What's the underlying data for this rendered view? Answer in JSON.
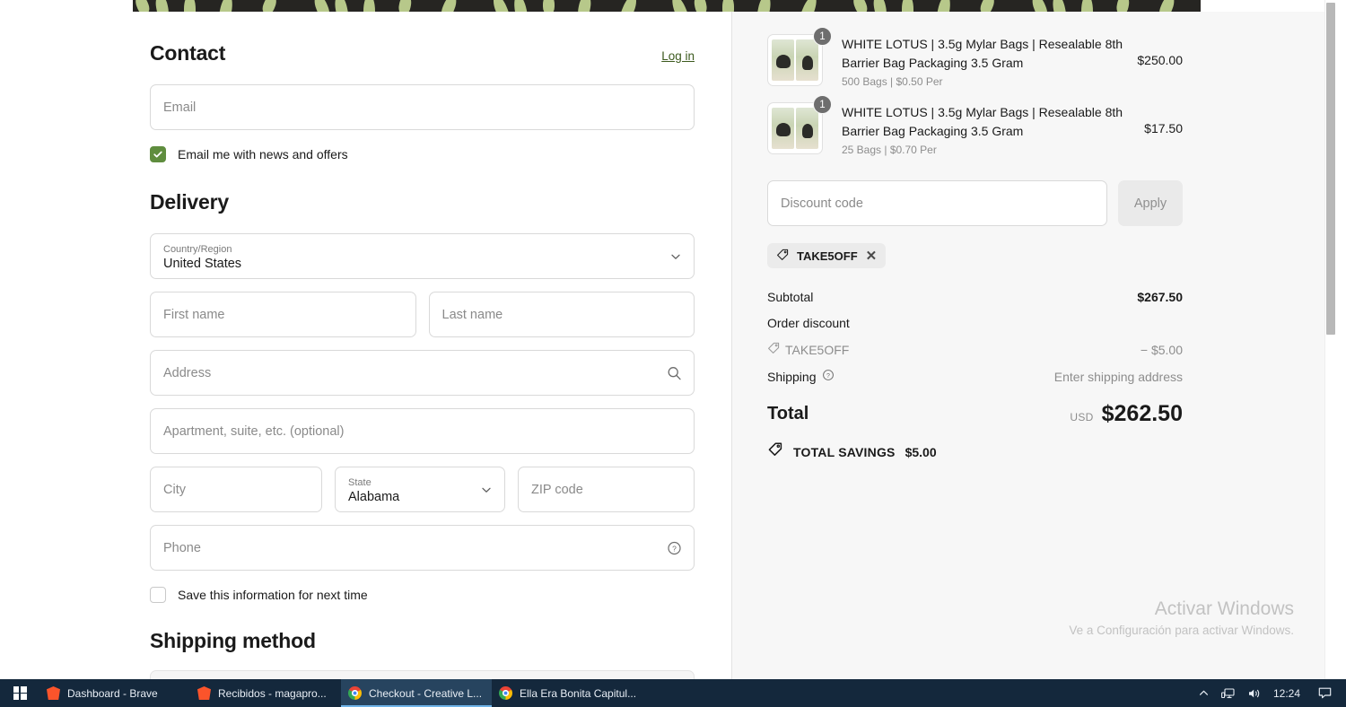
{
  "contact": {
    "title": "Contact",
    "login_label": "Log in",
    "email_placeholder": "Email",
    "newsletter_label": "Email me with news and offers",
    "newsletter_checked": true
  },
  "delivery": {
    "title": "Delivery",
    "country_label": "Country/Region",
    "country_value": "United States",
    "first_name_placeholder": "First name",
    "last_name_placeholder": "Last name",
    "address_placeholder": "Address",
    "apartment_placeholder": "Apartment, suite, etc. (optional)",
    "city_placeholder": "City",
    "state_label": "State",
    "state_value": "Alabama",
    "zip_placeholder": "ZIP code",
    "phone_placeholder": "Phone",
    "save_info_label": "Save this information for next time",
    "save_info_checked": false
  },
  "shipping_method": {
    "title": "Shipping method"
  },
  "summary": {
    "items": [
      {
        "title": "WHITE LOTUS | 3.5g Mylar Bags | Resealable 8th Barrier Bag Packaging 3.5 Gram",
        "variant": "500 Bags | $0.50 Per",
        "quantity": "1",
        "price": "$250.00"
      },
      {
        "title": "WHITE LOTUS | 3.5g Mylar Bags | Resealable 8th Barrier Bag Packaging 3.5 Gram",
        "variant": "25 Bags | $0.70 Per",
        "quantity": "1",
        "price": "$17.50"
      }
    ],
    "discount_placeholder": "Discount code",
    "apply_label": "Apply",
    "applied_code": "TAKE5OFF",
    "subtotal_label": "Subtotal",
    "subtotal_value": "$267.50",
    "order_discount_label": "Order discount",
    "discount_code_label": "TAKE5OFF",
    "discount_value": "− $5.00",
    "shipping_label": "Shipping",
    "shipping_value": "Enter shipping address",
    "total_label": "Total",
    "currency": "USD",
    "total_value": "$262.50",
    "savings_label": "TOTAL SAVINGS",
    "savings_value": "$5.00"
  },
  "watermark": {
    "line1": "Activar Windows",
    "line2": "Ve a Configuración para activar Windows."
  },
  "taskbar": {
    "items": [
      {
        "label": "Dashboard - Brave",
        "icon": "brave-icon",
        "active": false
      },
      {
        "label": "Recibidos - magapro...",
        "icon": "brave-icon",
        "active": false
      },
      {
        "label": "Checkout - Creative L...",
        "icon": "chrome-icon",
        "active": true
      },
      {
        "label": "Ella Era Bonita Capitul...",
        "icon": "chrome-icon",
        "active": false
      }
    ],
    "clock": "12:24"
  },
  "colors": {
    "accent_green": "#5f8d3e",
    "link_green": "#3c5a1e",
    "panel_bg": "#f7f7f7",
    "taskbar_bg": "#14283c"
  }
}
